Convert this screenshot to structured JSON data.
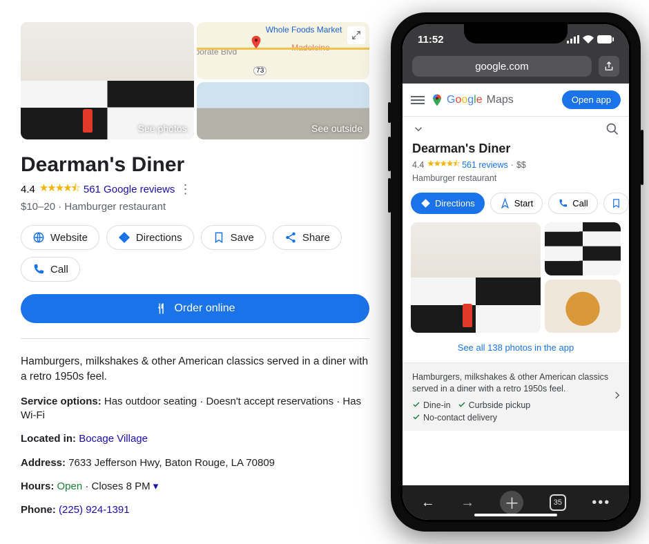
{
  "desktop": {
    "see_photos": "See photos",
    "see_outside": "See outside",
    "map_labels": {
      "whole_foods": "Whole Foods Market",
      "madeleine": "Madeleine",
      "corporate": "rporate Blvd",
      "route": "73"
    },
    "title": "Dearman's Diner",
    "rating": "4.4",
    "stars": "★★★★⯪",
    "reviews": "561 Google reviews",
    "price_category": "$10–20 · Hamburger restaurant",
    "buttons": {
      "website": "Website",
      "directions": "Directions",
      "save": "Save",
      "share": "Share",
      "call": "Call"
    },
    "order_online": "Order online",
    "description": "Hamburgers, milkshakes & other American classics served in a diner with a retro 1950s feel.",
    "service_label": "Service options:",
    "service_value": " Has outdoor seating · Doesn't accept reservations · Has Wi-Fi",
    "located_label": "Located in:",
    "located_value": "Bocage Village",
    "address_label": "Address:",
    "address_value": " 7633 Jefferson Hwy, Baton Rouge, LA 70809",
    "hours_label": "Hours:",
    "hours_open": "Open",
    "hours_rest": " · Closes 8 PM",
    "phone_label": "Phone:",
    "phone_value": "(225) 924-1391"
  },
  "mobile": {
    "status_time": "11:52",
    "url": "google.com",
    "maps_brand": "Google",
    "maps_suffix": "Maps",
    "open_app": "Open app",
    "title": "Dearman's Diner",
    "rating": "4.4",
    "stars": "★★★★⯪",
    "reviews": "561 reviews",
    "price": "$$",
    "category": "Hamburger restaurant",
    "buttons": {
      "directions": "Directions",
      "start": "Start",
      "call": "Call"
    },
    "see_all": "See all 138 photos in the app",
    "description": "Hamburgers, milkshakes & other American classics served in a diner with a retro 1950s feel.",
    "checks": {
      "dine": "Dine-in",
      "curb": "Curbside pickup",
      "deliv": "No-contact delivery"
    },
    "tab_count": "35"
  }
}
